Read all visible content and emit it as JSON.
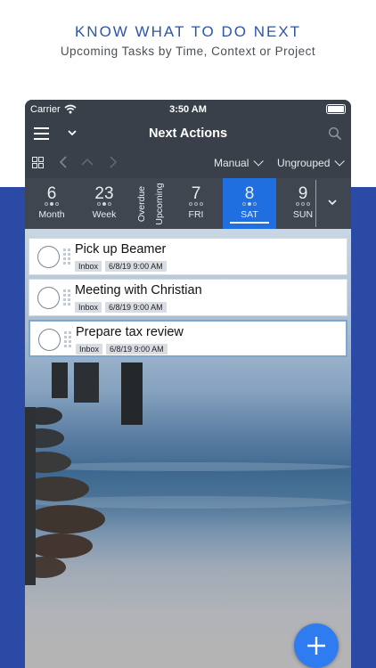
{
  "promo": {
    "title": "KNOW WHAT TO DO NEXT",
    "subtitle": "Upcoming Tasks by Time, Context or Project"
  },
  "statusbar": {
    "carrier": "Carrier",
    "time": "3:50 AM",
    "icons": [
      "wifi-icon",
      "battery-icon"
    ]
  },
  "navbar": {
    "title": "Next Actions",
    "icons": [
      "menu-icon",
      "chevron-down-icon",
      "search-icon"
    ]
  },
  "toolbar": {
    "sort": "Manual",
    "group": "Ungrouped",
    "icons": [
      "grid-icon",
      "chevron-left-icon",
      "chevron-up-icon",
      "chevron-right-icon"
    ]
  },
  "date_strip": {
    "month": {
      "number": "6",
      "label": "Month"
    },
    "week": {
      "number": "23",
      "label": "Week"
    },
    "overdue": "Overdue",
    "upcoming": "Upcoming",
    "days": [
      {
        "number": "7",
        "label": "FRI",
        "selected": false
      },
      {
        "number": "8",
        "label": "SAT",
        "selected": true
      },
      {
        "number": "9",
        "label": "SUN",
        "selected": false
      }
    ],
    "selected_color": "#1f6fe0"
  },
  "tasks": [
    {
      "title": "Pick up Beamer",
      "context": "Inbox",
      "date": "6/8/19 9:00 AM"
    },
    {
      "title": "Meeting with Christian",
      "context": "Inbox",
      "date": "6/8/19 9:00 AM"
    },
    {
      "title": "Prepare tax review",
      "context": "Inbox",
      "date": "6/8/19 9:00 AM"
    }
  ],
  "fab": {
    "icon": "plus-icon",
    "color": "#2f7cf0"
  },
  "colors": {
    "accent_blue": "#2b4aa6",
    "promo_title": "#2d55a8",
    "app_bar": "#3a4049"
  }
}
